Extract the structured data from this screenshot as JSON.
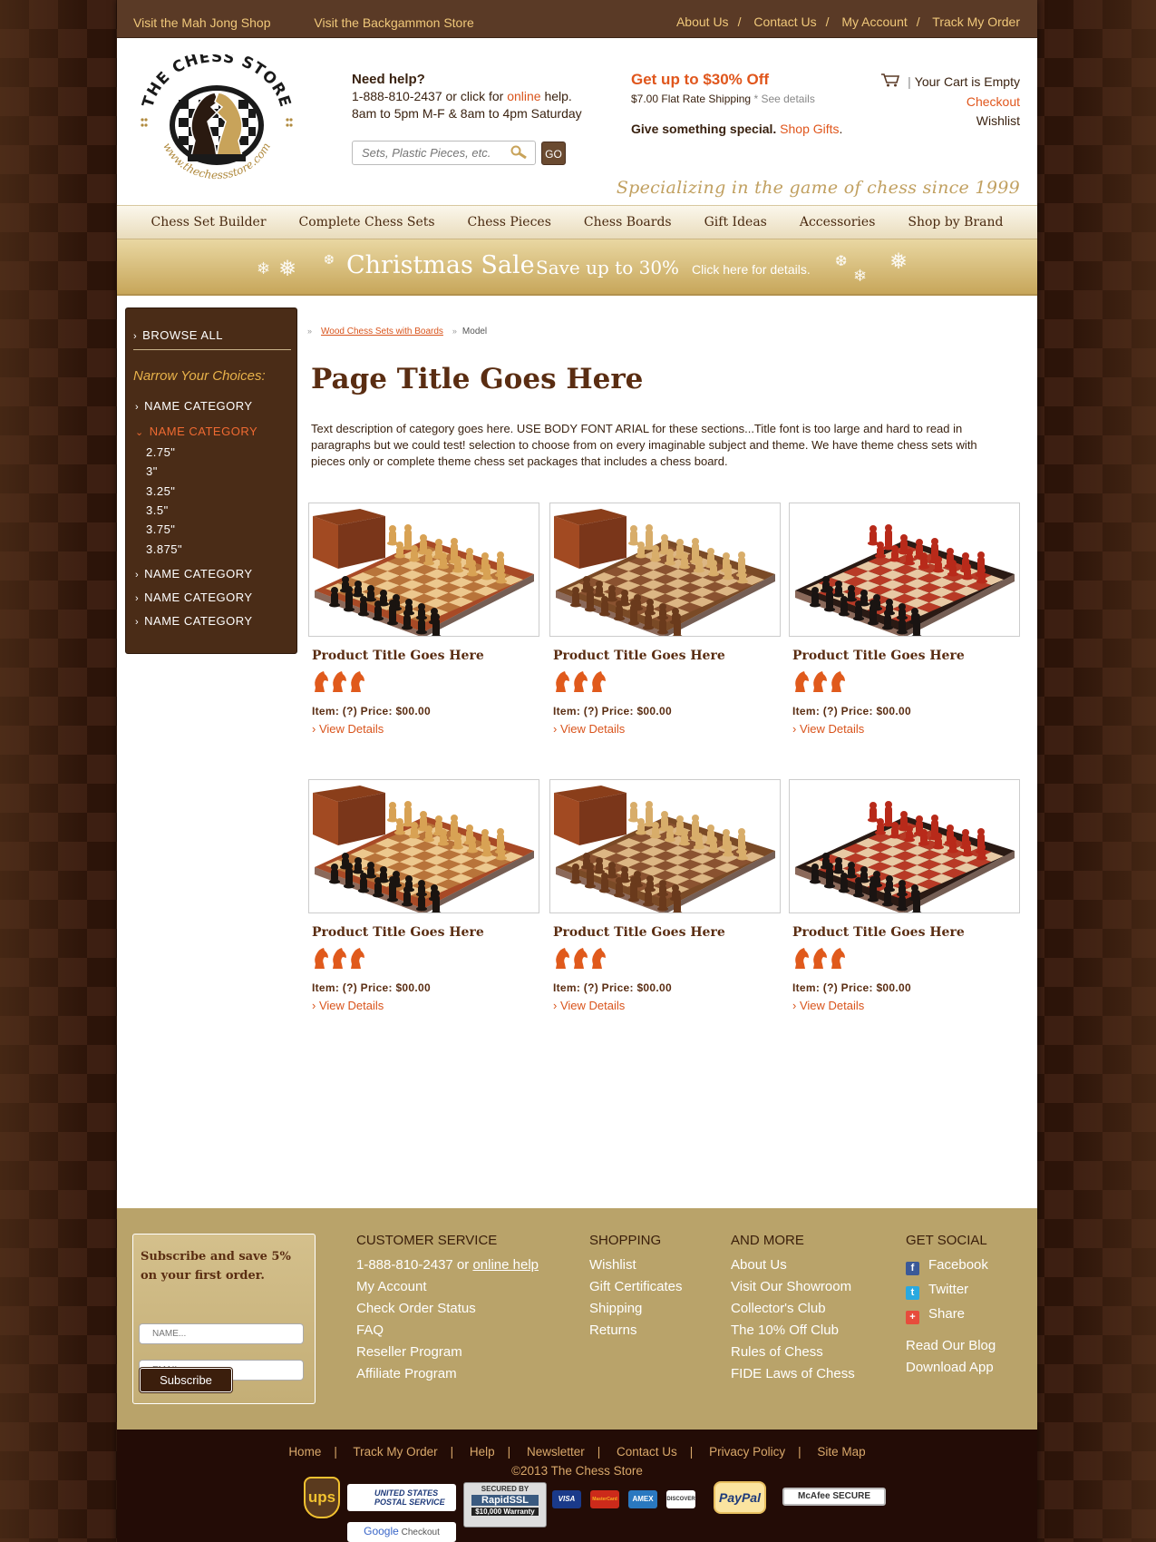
{
  "topbar": {
    "left": [
      "Visit the Mah Jong Shop",
      "Visit the Backgammon Store"
    ],
    "right": [
      "About Us",
      "Contact Us",
      "My Account",
      "Track My Order"
    ],
    "sep": "/"
  },
  "header": {
    "logo_text": "THE CHESS STORE",
    "logo_url": "www.thechessstore.com",
    "help_title": "Need help?",
    "help_line1_pre": "1-888-810-2437 or click for ",
    "help_line1_link": "online",
    "help_line1_post": " help.",
    "help_line2": "8am to 5pm M-F & 8am to 4pm Saturday",
    "search_placeholder": "Sets, Plastic Pieces, etc.",
    "go_label": "GO",
    "promo_title": "Get up to $30% Off",
    "promo_ship": "$7.00 Flat Rate Shipping",
    "promo_ship_details": "* See details",
    "promo_gift_pre": "Give something special",
    "promo_gift_dot": ".",
    "promo_gift_link": "Shop Gifts",
    "promo_gift_end": ".",
    "cart_sep": "|",
    "cart_text": "Your Cart is Empty",
    "checkout": "Checkout",
    "wishlist": "Wishlist",
    "tagline": "Specializing in the game of chess since 1999"
  },
  "nav": [
    "Chess Set Builder",
    "Complete Chess Sets",
    "Chess Pieces",
    "Chess Boards",
    "Gift Ideas",
    "Accessories",
    "Shop by Brand"
  ],
  "banner": {
    "title": "Christmas Sale",
    "subtitle": "Save up to 30%",
    "cta": "Click here for details."
  },
  "sidebar": {
    "browse_all": "BROWSE ALL",
    "narrow": "Narrow Your Choices:",
    "categories": [
      "NAME CATEGORY",
      "NAME CATEGORY",
      "NAME CATEGORY",
      "NAME CATEGORY",
      "NAME CATEGORY"
    ],
    "sizes": [
      "2.75\"",
      "3\"",
      "3.25\"",
      "3.5\"",
      "3.75\"",
      "3.875\""
    ]
  },
  "breadcrumb": {
    "link": "Wood Chess Sets with Boards",
    "current": "Model",
    "sep": "»"
  },
  "page": {
    "title": "Page Title Goes Here",
    "description": "Text description of category goes here. USE BODY FONT ARIAL for these sections...Title font is too large and hard to read in paragraphs but we could test! selection to choose from on every imaginable subject and theme. We have theme chess sets with pieces only or complete theme chess set packages that includes a chess board."
  },
  "products": [
    {
      "title": "Product Title Goes Here",
      "price": "Item: (?) Price: $00.00",
      "link": "View Details",
      "rating": 3,
      "style": "boxed-light"
    },
    {
      "title": "Product Title Goes Here",
      "price": "Item: (?) Price: $00.00",
      "link": "View Details",
      "rating": 3,
      "style": "boxed-walnut"
    },
    {
      "title": "Product Title Goes Here",
      "price": "Item: (?) Price: $00.00",
      "link": "View Details",
      "rating": 3,
      "style": "red-black"
    },
    {
      "title": "Product Title Goes Here",
      "price": "Item: (?) Price: $00.00",
      "link": "View Details",
      "rating": 3,
      "style": "boxed-light"
    },
    {
      "title": "Product Title Goes Here",
      "price": "Item: (?) Price: $00.00",
      "link": "View Details",
      "rating": 3,
      "style": "boxed-walnut"
    },
    {
      "title": "Product Title Goes Here",
      "price": "Item: (?) Price: $00.00",
      "link": "View Details",
      "rating": 3,
      "style": "red-black"
    }
  ],
  "footer": {
    "subscribe_title": "Subscribe and save 5% on your first order.",
    "name_placeholder": "NAME...",
    "email_placeholder": "EMAIL...",
    "subscribe_btn": "Subscribe",
    "customer_service": {
      "heading": "CUSTOMER SERVICE",
      "phone_pre": "1-888-810-2437 or ",
      "phone_link": "online help",
      "items": [
        "My Account",
        "Check Order Status",
        "FAQ",
        "Reseller Program",
        "Affiliate Program"
      ]
    },
    "shopping": {
      "heading": "SHOPPING",
      "items": [
        "Wishlist",
        "Gift Certificates",
        "Shipping",
        "Returns"
      ]
    },
    "more": {
      "heading": "AND MORE",
      "items": [
        "About Us",
        "Visit Our Showroom",
        "Collector's Club",
        "The 10% Off Club",
        "Rules of Chess",
        "FIDE Laws of Chess"
      ]
    },
    "social": {
      "heading": "GET SOCIAL",
      "items": [
        "Facebook",
        "Twitter",
        "Share"
      ],
      "extra": [
        "Read Our Blog",
        "Download App"
      ]
    }
  },
  "bottom": {
    "links": [
      "Home",
      "Track My Order",
      "Help",
      "Newsletter",
      "Contact Us",
      "Privacy Policy",
      "Site Map"
    ],
    "sep": "|",
    "copyright": "©2013 The Chess Store",
    "badges": {
      "ups": "ups",
      "usps": "UNITED STATES POSTAL SERVICE",
      "ssl_top": "SECURED BY",
      "ssl": "RapidSSL",
      "ssl_warranty": "$10,000 Warranty",
      "visa": "VISA",
      "mastercard": "MasterCard",
      "amex": "AMEX",
      "discover": "DISCOVER",
      "paypal": "PayPal",
      "mcafee": "McAfee SECURE",
      "google": "Google",
      "google_checkout": "Checkout"
    }
  },
  "colors": {
    "accent": "#e0561c",
    "brown": "#4a2c17",
    "gold": "#b9a36a",
    "topbar": "#5a3a26"
  }
}
